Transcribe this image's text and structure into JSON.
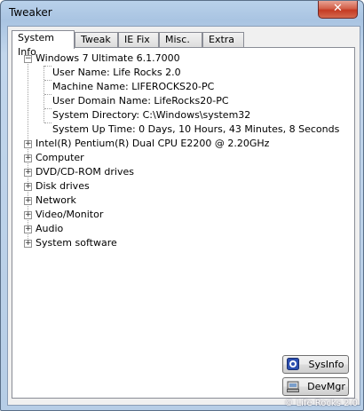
{
  "window": {
    "title": "Tweaker",
    "close_label": "✕"
  },
  "tabs": [
    {
      "label": "System Info",
      "active": true
    },
    {
      "label": "Tweak",
      "active": false
    },
    {
      "label": "IE Fix",
      "active": false
    },
    {
      "label": "Misc.",
      "active": false
    },
    {
      "label": "Extra",
      "active": false
    }
  ],
  "tree": {
    "root": {
      "label": "Windows 7 Ultimate 6.1.7000",
      "expanded": true,
      "children": [
        "User Name: Life Rocks 2.0",
        "Machine Name: LIFEROCKS20-PC",
        "User Domain Name: LifeRocks20-PC",
        "System Directory: C:\\Windows\\system32",
        "System Up Time: 0 Days, 10 Hours, 43 Minutes, 8 Seconds"
      ]
    },
    "collapsed_nodes": [
      "Intel(R) Pentium(R) Dual  CPU  E2200  @ 2.20GHz",
      "Computer",
      "DVD/CD-ROM drives",
      "Disk drives",
      "Network",
      "Video/Monitor",
      "Audio",
      "System software"
    ]
  },
  "buttons": {
    "sysinfo": "SysInfo",
    "devmgr": "DevMgr"
  },
  "footer": "© Life Rocks 2.0",
  "icons": {
    "sysinfo": "system-info-icon",
    "devmgr": "device-manager-icon"
  }
}
